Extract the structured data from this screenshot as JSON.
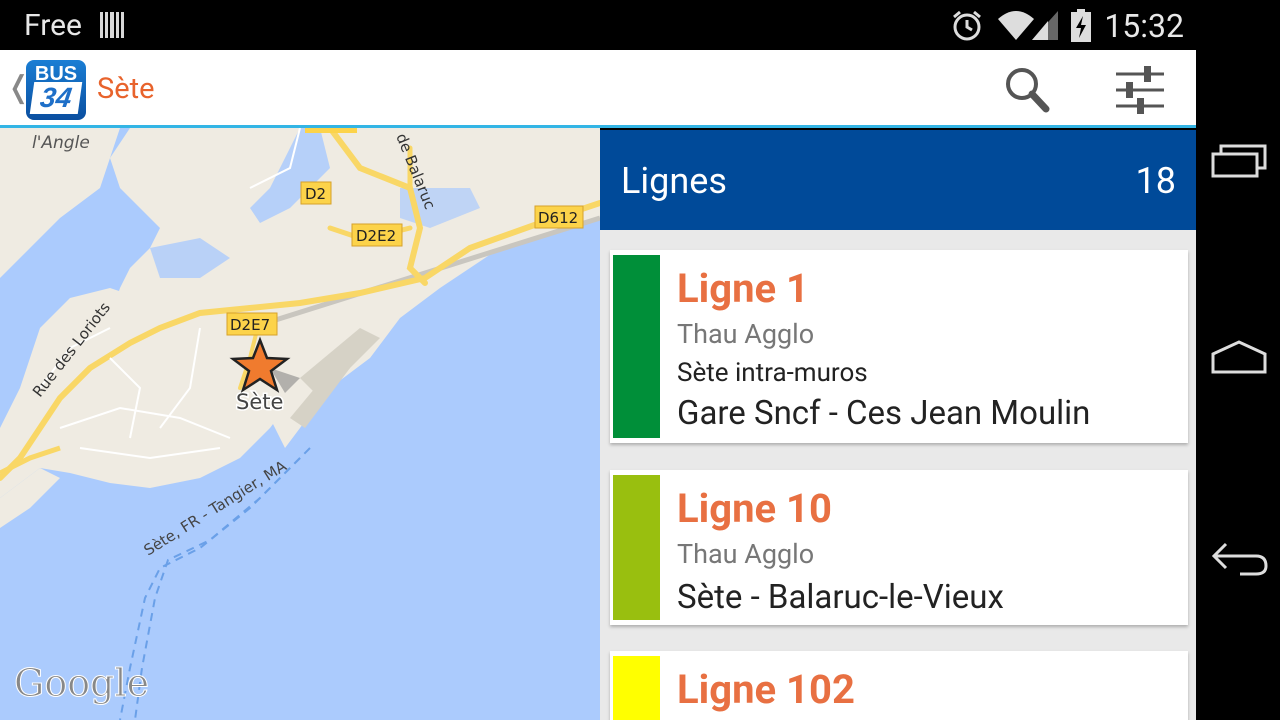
{
  "status_bar": {
    "carrier": "Free",
    "time": "15:32"
  },
  "action_bar": {
    "title": "Sète",
    "logo_top": "BUS",
    "logo_number": "34",
    "up_icon": "chevron-left-icon",
    "search_icon": "search-icon",
    "settings_icon": "settings-sliders-icon"
  },
  "map": {
    "labels": {
      "angle": "l'Angle",
      "balaruc": "de Balaruc",
      "loriots": "Rue des Loriots",
      "city": "Sète",
      "ferry": "Sète, FR - Tangier, MA",
      "google": "Google"
    },
    "road_shields": [
      "D2",
      "D2E2",
      "D612",
      "D2E7"
    ]
  },
  "lines_panel": {
    "title": "Lignes",
    "count": "18",
    "lines": [
      {
        "name": "Ligne 1",
        "network": "Thau Agglo",
        "subtitle": "Sète intra-muros",
        "route": "Gare Sncf - Ces Jean Moulin",
        "color": "#008f39"
      },
      {
        "name": "Ligne 10",
        "network": "Thau Agglo",
        "subtitle": "",
        "route": "Sète - Balaruc-le-Vieux",
        "color": "#99bf0f"
      },
      {
        "name": "Ligne 102",
        "network": "",
        "subtitle": "",
        "route": "",
        "color": "#ffff00"
      }
    ]
  },
  "nav_bar": {
    "recents_icon": "recents-icon",
    "home_icon": "home-icon",
    "back_icon": "back-icon"
  },
  "colors": {
    "accent": "#e8632c",
    "header_blue": "#004a99",
    "divider": "#33b5e5"
  }
}
